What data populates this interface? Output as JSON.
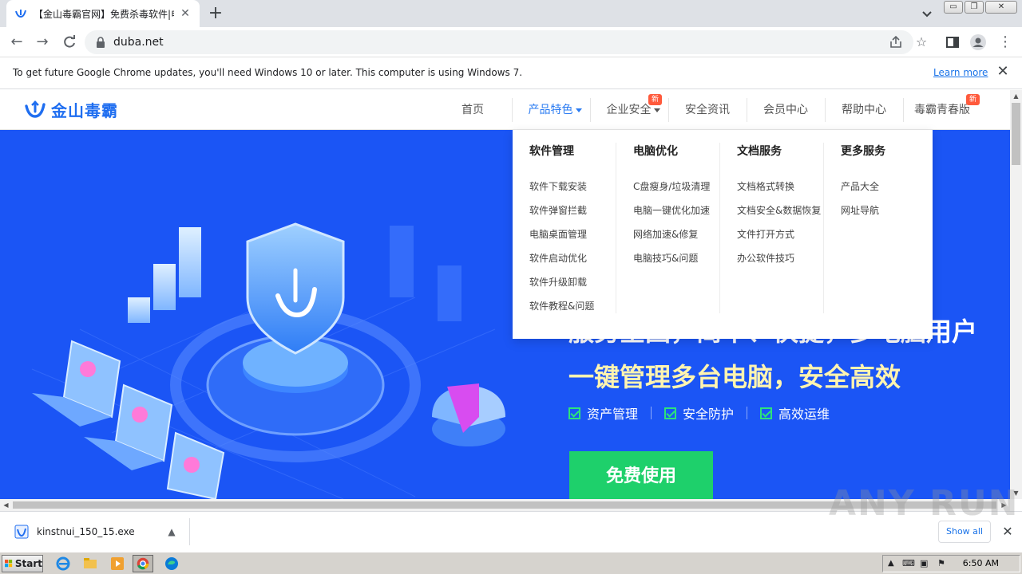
{
  "browser": {
    "tab": {
      "title": "【金山毒霸官网】免费杀毒软件|电脑",
      "close": "✕"
    },
    "new_tab": "+",
    "address": {
      "url": "duba.net"
    },
    "window_buttons": {
      "minimize": "▭",
      "restore": "❐",
      "close": "✕"
    }
  },
  "infobar": {
    "message": "To get future Google Chrome updates, you'll need Windows 10 or later. This computer is using Windows 7.",
    "link": "Learn more",
    "close": "✕"
  },
  "site": {
    "logo_text": "金山毒霸",
    "nav": [
      {
        "label": "首页"
      },
      {
        "label": "产品特色"
      },
      {
        "label": "企业安全",
        "badge": "新"
      },
      {
        "label": "安全资讯"
      },
      {
        "label": "会员中心"
      },
      {
        "label": "帮助中心"
      },
      {
        "label": "毒霸青春版",
        "badge": "新"
      }
    ],
    "dropdown": [
      {
        "title": "软件管理",
        "items": [
          "软件下载安装",
          "软件弹窗拦截",
          "电脑桌面管理",
          "软件启动优化",
          "软件升级卸载",
          "软件教程&问题"
        ]
      },
      {
        "title": "电脑优化",
        "items": [
          "C盘瘦身/垃圾清理",
          "电脑一键优化加速",
          "网络加速&修复",
          "电脑技巧&问题"
        ]
      },
      {
        "title": "文档服务",
        "items": [
          "文档格式转换",
          "文档安全&数据恢复",
          "文件打开方式",
          "办公软件技巧"
        ]
      },
      {
        "title": "更多服务",
        "items": [
          "产品大全",
          "网址导航"
        ]
      }
    ],
    "hero": {
      "line1": "服务全国，简单、快捷，多电脑用户",
      "line2": "一键管理多台电脑，安全高效",
      "features": [
        "资产管理",
        "安全防护",
        "高效运维"
      ],
      "cta": "免费使用"
    }
  },
  "downloads": {
    "file": "kinstnui_150_15.exe",
    "show_all": "Show all",
    "close": "✕"
  },
  "watermark": "ANY RUN",
  "taskbar": {
    "start": "Start",
    "clock": "6:50 AM"
  },
  "colors": {
    "hero_bg": "#1b55f5",
    "accent": "#2a7bf2",
    "cta_green": "#1ed06b",
    "badge_red": "#ff5a3c"
  }
}
